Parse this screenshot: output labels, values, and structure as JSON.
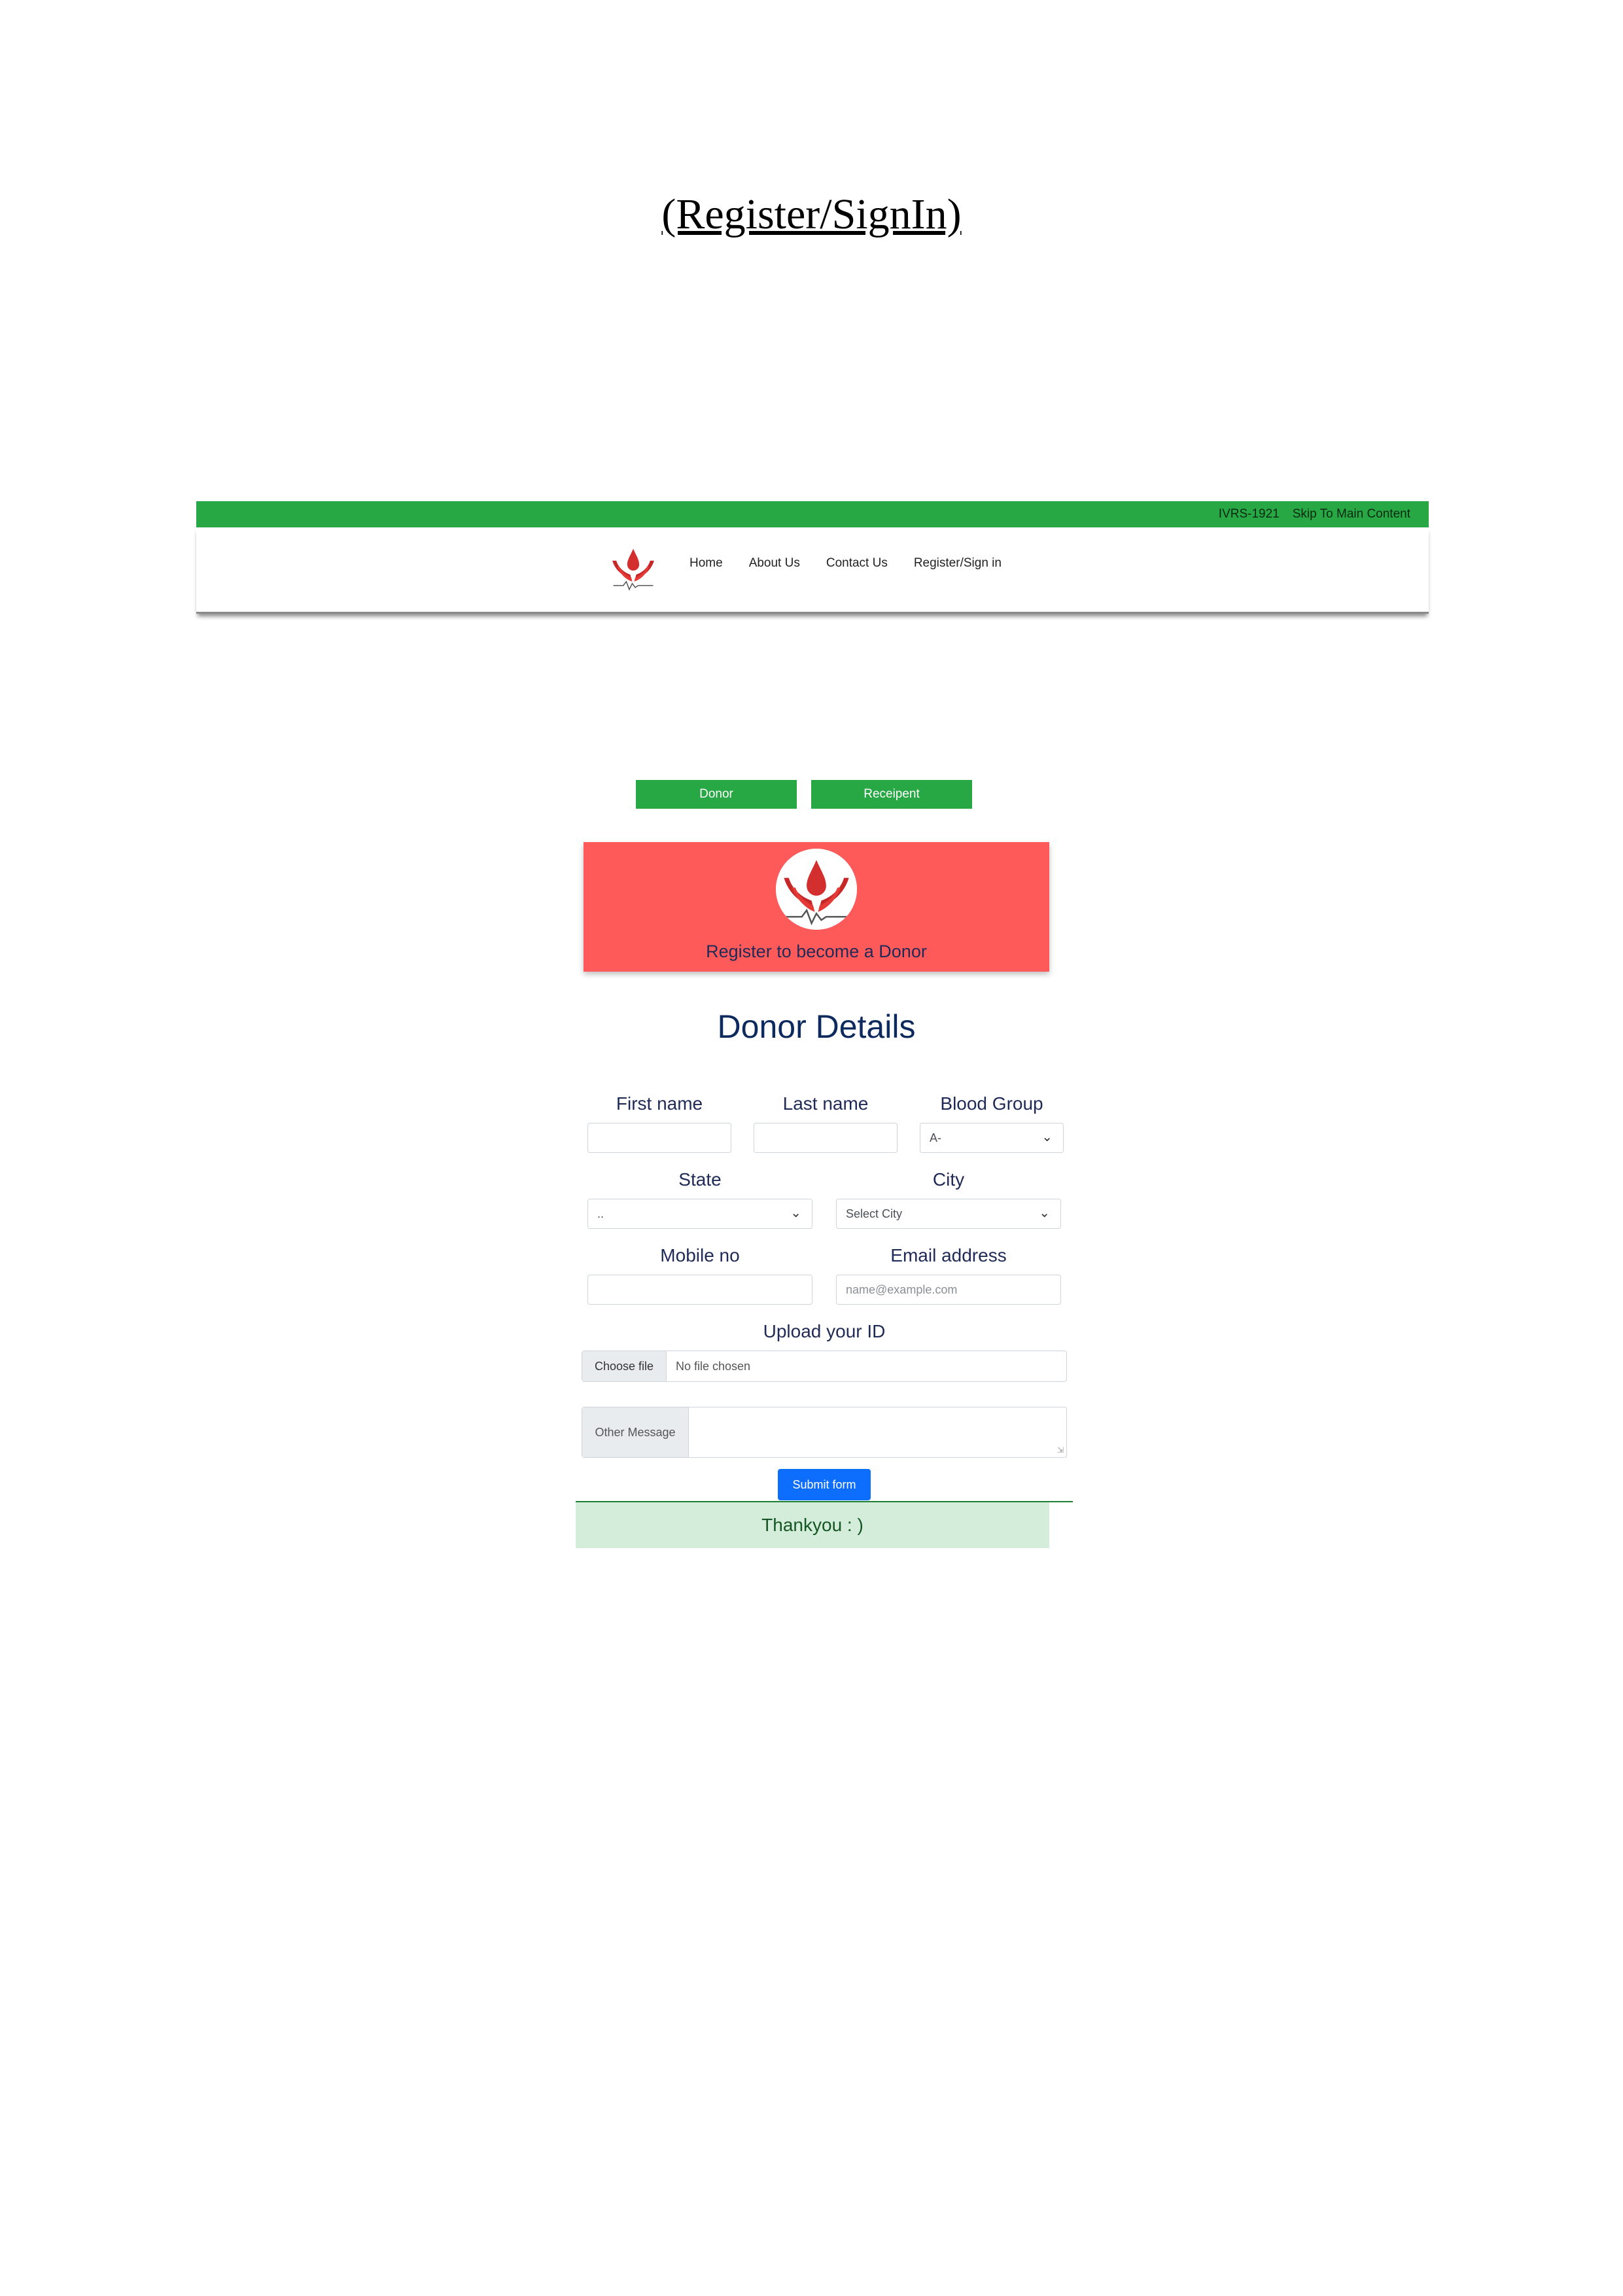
{
  "document": {
    "heading": "(Register/SignIn)"
  },
  "topbar": {
    "helpline": "IVRS-1921",
    "skip_link": "Skip To Main Content"
  },
  "nav": {
    "links": [
      "Home",
      "About Us",
      "Contact Us",
      "Register/Sign in"
    ]
  },
  "tabs": {
    "donor": "Donor",
    "recipient": "Receipent"
  },
  "banner": {
    "text": "Register to become a Donor"
  },
  "form": {
    "title": "Donor Details",
    "first_name_label": "First name",
    "last_name_label": "Last name",
    "blood_group_label": "Blood Group",
    "blood_group_value": "A-",
    "state_label": "State",
    "state_value": "..",
    "city_label": "City",
    "city_value": "Select City",
    "mobile_label": "Mobile no",
    "email_label": "Email address",
    "email_placeholder": "name@example.com",
    "upload_label": "Upload your ID",
    "choose_file": "Choose file",
    "file_status": "No file chosen",
    "message_label": "Other Message",
    "submit_label": "Submit form"
  },
  "alert": {
    "text": "Thankyou : )"
  },
  "colors": {
    "green": "#28a745",
    "banner_red": "#ff5a5a",
    "navy": "#1f2a57",
    "blue": "#0d6efd",
    "success_bg": "#d4edda"
  },
  "icons": [
    "blood-drop-hands-logo",
    "chevron-down-icon"
  ]
}
